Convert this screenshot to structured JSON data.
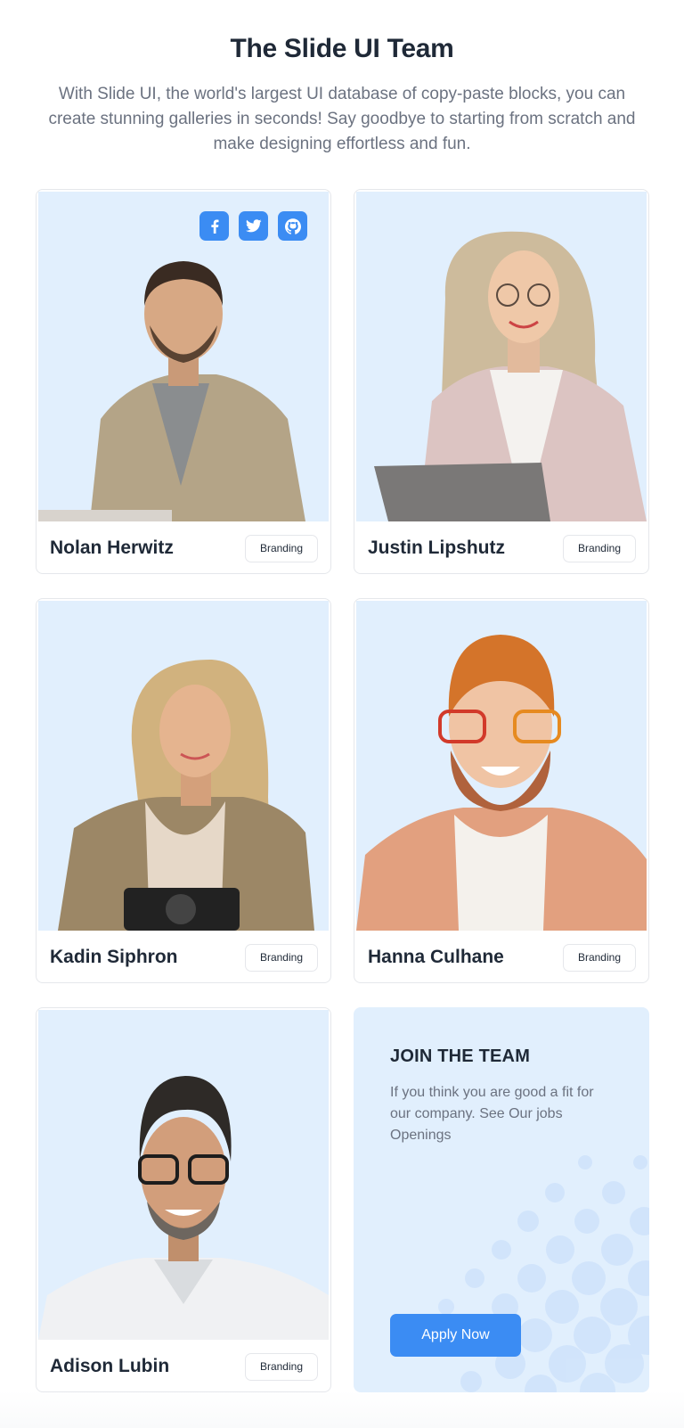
{
  "header": {
    "title": "The Slide UI Team",
    "subtitle": "With Slide UI, the world's largest UI database of copy-paste blocks, you can create stunning galleries in seconds! Say goodbye to starting from scratch and make designing effortless and fun."
  },
  "team": [
    {
      "name": "Nolan Herwitz",
      "tag": "Branding",
      "photo": "man-curly-hair-jacket-portrait"
    },
    {
      "name": "Justin Lipshutz",
      "tag": "Branding",
      "photo": "woman-glasses-laptop-portrait"
    },
    {
      "name": "Kadin Siphron",
      "tag": "Branding",
      "photo": "woman-blonde-camera-portrait"
    },
    {
      "name": "Hanna Culhane",
      "tag": "Branding",
      "photo": "man-beanie-beard-portrait"
    },
    {
      "name": "Adison Lubin",
      "tag": "Branding",
      "photo": "man-glasses-shirt-portrait"
    }
  ],
  "socials": [
    {
      "icon": "facebook-icon"
    },
    {
      "icon": "twitter-icon"
    },
    {
      "icon": "github-icon"
    }
  ],
  "join": {
    "title": "JOIN THE TEAM",
    "text": "If you think you are good a fit for our company. See Our jobs Openings",
    "button_label": "Apply Now"
  },
  "colors": {
    "accent": "#3b8cf3",
    "card_bg": "#e1effd",
    "heading": "#1f2937",
    "muted": "#6b7280"
  }
}
